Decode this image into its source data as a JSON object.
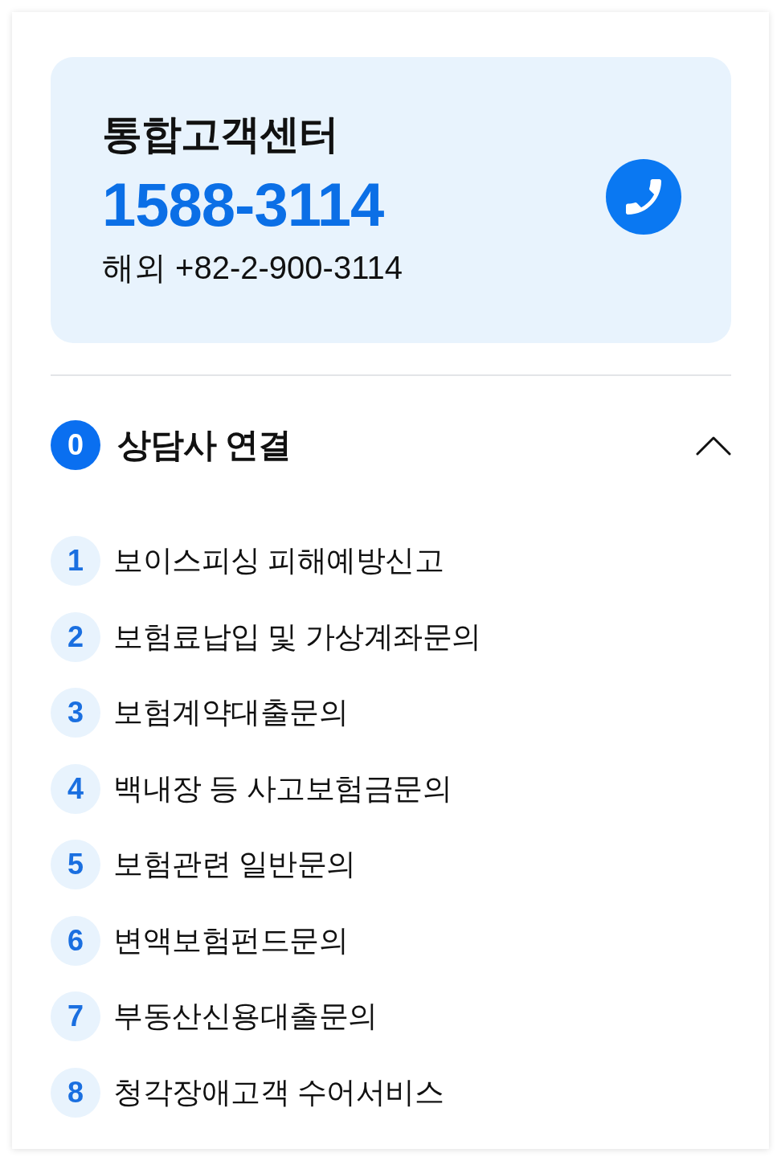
{
  "contact_card": {
    "title": "통합고객센터",
    "phone": "1588-3114",
    "overseas": "해외 +82-2-900-3114"
  },
  "menu": {
    "number": "0",
    "title": "상담사 연결",
    "expanded": true,
    "items": [
      {
        "number": "1",
        "label": "보이스피싱 피해예방신고"
      },
      {
        "number": "2",
        "label": "보험료납입 및 가상계좌문의"
      },
      {
        "number": "3",
        "label": "보험계약대출문의"
      },
      {
        "number": "4",
        "label": "백내장 등 사고보험금문의"
      },
      {
        "number": "5",
        "label": "보험관련 일반문의"
      },
      {
        "number": "6",
        "label": "변액보험펀드문의"
      },
      {
        "number": "7",
        "label": "부동산신용대출문의"
      },
      {
        "number": "8",
        "label": "청각장애고객 수어서비스"
      }
    ]
  }
}
